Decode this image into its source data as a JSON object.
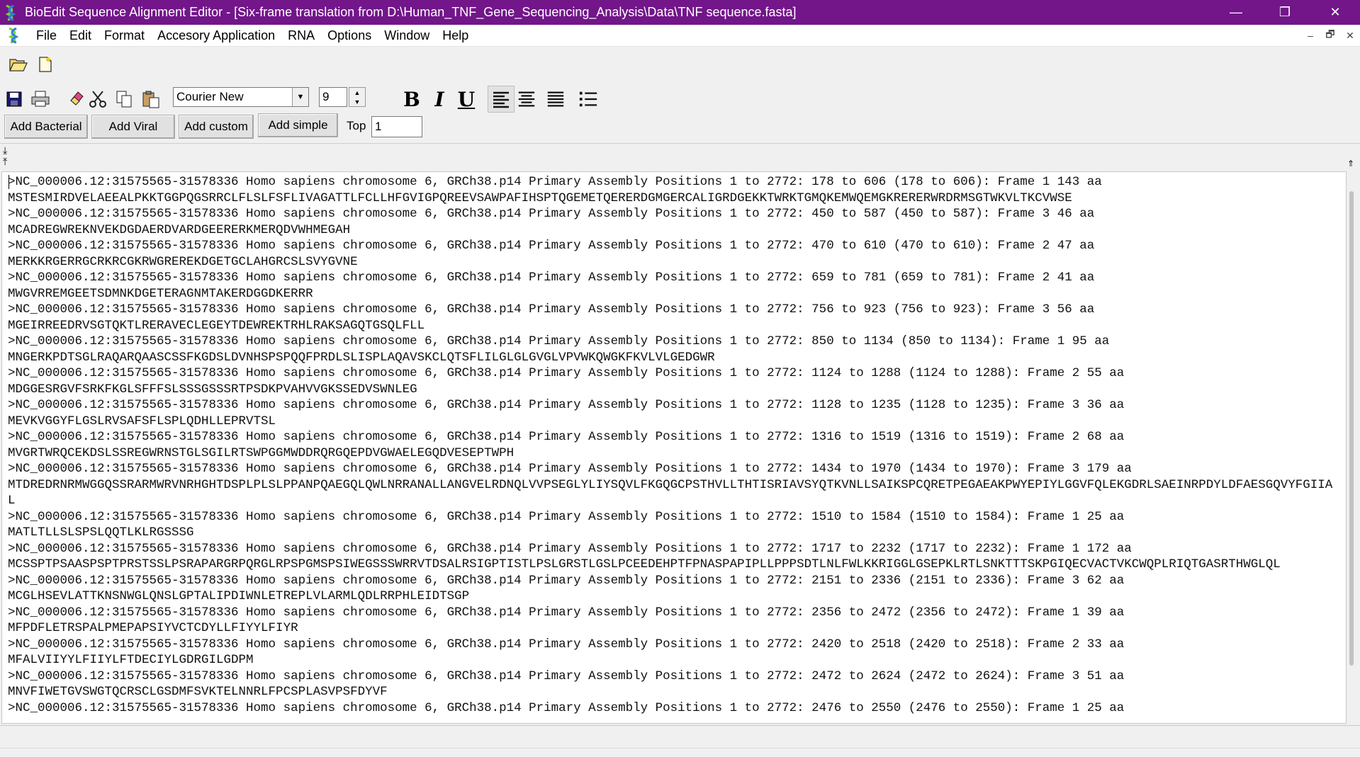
{
  "window": {
    "title": "BioEdit Sequence Alignment Editor - [Six-frame translation from D:\\Human_TNF_Gene_Sequencing_Analysis\\Data\\TNF sequence.fasta]",
    "title_bar_color": "#72168a",
    "controls": {
      "minimize": "—",
      "restore": "❐",
      "close": "✕"
    }
  },
  "menu": {
    "items": [
      "File",
      "Edit",
      "Format",
      "Accesory Application",
      "RNA",
      "Options",
      "Window",
      "Help"
    ],
    "mdi_controls": {
      "minimize": "–",
      "restore": "🗗",
      "close": "✕"
    }
  },
  "toolbar": {
    "font_name": "Courier New",
    "font_size": "9",
    "bold": "B",
    "italic": "I",
    "underline": "U",
    "add_bacterial": "Add Bacterial",
    "add_viral": "Add Viral",
    "add_custom": "Add custom",
    "add_simple": "Add simple",
    "top_label": "Top",
    "top_value": "1"
  },
  "icons": [
    "folder-open-icon",
    "new-document-icon",
    "save-icon",
    "print-icon",
    "eraser-icon",
    "scissors-icon",
    "copy-icon",
    "paste-icon",
    "align-left-icon",
    "align-center-icon",
    "align-justify-icon",
    "bullet-list-icon",
    "split-down-arrow-icon",
    "split-up-arrow-icon",
    "scroll-top-icon"
  ],
  "editor": {
    "lines": [
      ">NC_000006.12:31575565-31578336 Homo sapiens chromosome 6, GRCh38.p14 Primary Assembly Positions 1 to 2772: 178 to 606 (178 to 606): Frame 1 143 aa",
      "MSTESMIRDVELAEEALPKKTGGPQGSRRCLFLSLFSFLIVAGATTLFCLLHFGVIGPQREEVSAWPAFIHSPTQGEMETQERERDGMGERCALIGRDGEKKTWRKTGMQKEMWQEMGKRERERWRDRMSGTWKVLTKCVWSE",
      ">NC_000006.12:31575565-31578336 Homo sapiens chromosome 6, GRCh38.p14 Primary Assembly Positions 1 to 2772: 450 to 587 (450 to 587): Frame 3 46 aa",
      "MCADREGWREKNVEKDGDAERDVARDGEERERKMERQDVWHMEGAH",
      ">NC_000006.12:31575565-31578336 Homo sapiens chromosome 6, GRCh38.p14 Primary Assembly Positions 1 to 2772: 470 to 610 (470 to 610): Frame 2 47 aa",
      "MERKKRGERRGCRKRCGKRWGREREKDGETGCLAHGRCSLSVYGVNE",
      ">NC_000006.12:31575565-31578336 Homo sapiens chromosome 6, GRCh38.p14 Primary Assembly Positions 1 to 2772: 659 to 781 (659 to 781): Frame 2 41 aa",
      "MWGVRREMGEETSDMNKDGETERAGNMTAKERDGGDKERRR",
      ">NC_000006.12:31575565-31578336 Homo sapiens chromosome 6, GRCh38.p14 Primary Assembly Positions 1 to 2772: 756 to 923 (756 to 923): Frame 3 56 aa",
      "MGEIRREEDRVSGTQKTLRERAVECLEGEYTDEWREKTRHLRAKSAGQTGSQLFLL",
      ">NC_000006.12:31575565-31578336 Homo sapiens chromosome 6, GRCh38.p14 Primary Assembly Positions 1 to 2772: 850 to 1134 (850 to 1134): Frame 1 95 aa",
      "MNGERKPDTSGLRAQARQAASCSSFKGDSLDVNHSPSPQQFPRDLSLISPLAQAVSKCLQTSFLILGLGLGVGLVPVWKQWGKFKVLVLGEDGWR",
      ">NC_000006.12:31575565-31578336 Homo sapiens chromosome 6, GRCh38.p14 Primary Assembly Positions 1 to 2772: 1124 to 1288 (1124 to 1288): Frame 2 55 aa",
      "MDGGESRGVFSRKFKGLSFFFSLSSSGSSSRTPSDKPVAHVVGKSSEDVSWNLEG",
      ">NC_000006.12:31575565-31578336 Homo sapiens chromosome 6, GRCh38.p14 Primary Assembly Positions 1 to 2772: 1128 to 1235 (1128 to 1235): Frame 3 36 aa",
      "MEVKVGGYFLGSLRVSAFSFLSPLQDHLLEPRVTSL",
      ">NC_000006.12:31575565-31578336 Homo sapiens chromosome 6, GRCh38.p14 Primary Assembly Positions 1 to 2772: 1316 to 1519 (1316 to 1519): Frame 2 68 aa",
      "MVGRTWRQCEKDSLSSREGWRNSTGLSGILRTSWPGGMWDDRQRGQEPDVGWAELEGQDVESEPTWPH",
      ">NC_000006.12:31575565-31578336 Homo sapiens chromosome 6, GRCh38.p14 Primary Assembly Positions 1 to 2772: 1434 to 1970 (1434 to 1970): Frame 3 179 aa",
      "MTDREDRNRMWGGQSSRARMWRVNRHGHTDSPLPLSLPPANPQAEGQLQWLNRRANALLANGVELRDNQLVVPSEGLYLIYSQVLFKGQGCPSTHVLLTHTISRIAVSYQTKVNLLSAIKSPCQRETPEGAEAKPWYEPIYLGGVFQLEKGDRLSAEINRPDYLDFAESGQVYFGIIA",
      "L",
      ">NC_000006.12:31575565-31578336 Homo sapiens chromosome 6, GRCh38.p14 Primary Assembly Positions 1 to 2772: 1510 to 1584 (1510 to 1584): Frame 1 25 aa",
      "MATLTLLSLSPSLQQTLKLRGSSSG",
      ">NC_000006.12:31575565-31578336 Homo sapiens chromosome 6, GRCh38.p14 Primary Assembly Positions 1 to 2772: 1717 to 2232 (1717 to 2232): Frame 1 172 aa",
      "MCSSPTPSAASPSPTPRSTSSLPSRAPARGRPQRGLRPSPGMSPSIWEGSSSWRRVTDSALRSIGPTISTLPSLGRSTLGSLPCEEDEHPTFPNASPAPIPLLPPPSDTLNLFWLKKRIGGLGSEPKLRTLSNKTTTSKPGIQECVACTVKCWQPLRIQTGASRTHWGLQL",
      ">NC_000006.12:31575565-31578336 Homo sapiens chromosome 6, GRCh38.p14 Primary Assembly Positions 1 to 2772: 2151 to 2336 (2151 to 2336): Frame 3 62 aa",
      "MCGLHSEVLATTKNSNWGLQNSLGPTALIPDIWNLETREPLVLARMLQDLRRPHLEIDTSGP",
      ">NC_000006.12:31575565-31578336 Homo sapiens chromosome 6, GRCh38.p14 Primary Assembly Positions 1 to 2772: 2356 to 2472 (2356 to 2472): Frame 1 39 aa",
      "MFPDFLETRSPALPMEPAPSIYVCTCDYLLFIYYLFIYR",
      ">NC_000006.12:31575565-31578336 Homo sapiens chromosome 6, GRCh38.p14 Primary Assembly Positions 1 to 2772: 2420 to 2518 (2420 to 2518): Frame 2 33 aa",
      "MFALVIIYYLFIIYLFTDECIYLGDRGILGDPM",
      ">NC_000006.12:31575565-31578336 Homo sapiens chromosome 6, GRCh38.p14 Primary Assembly Positions 1 to 2772: 2472 to 2624 (2472 to 2624): Frame 3 51 aa",
      "MNVFIWETGVSWGTQCRSCLGSDMFSVKTELNNRLFPCSPLASVPSFDYVF",
      ">NC_000006.12:31575565-31578336 Homo sapiens chromosome 6, GRCh38.p14 Primary Assembly Positions 1 to 2772: 2476 to 2550 (2476 to 2550): Frame 1 25 aa"
    ]
  }
}
